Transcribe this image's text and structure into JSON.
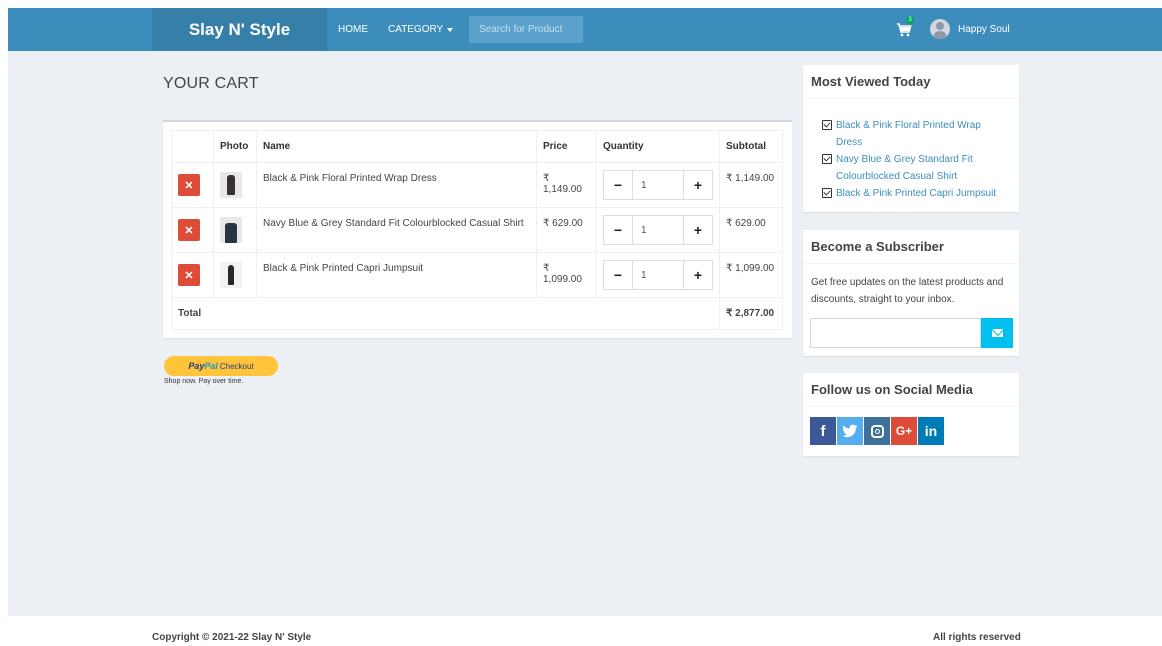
{
  "brand": {
    "name": "Slay N' Style"
  },
  "nav": {
    "home": "HOME",
    "category": "CATEGORY",
    "search_placeholder": "Search for Product",
    "cart_count": "3",
    "user_name": "Happy Soul"
  },
  "cart": {
    "title": "YOUR CART",
    "columns": [
      "",
      "Photo",
      "Name",
      "Price",
      "Quantity",
      "Subtotal"
    ],
    "items": [
      {
        "name": "Black & Pink Floral Printed Wrap Dress",
        "price": "₹ 1,149.00",
        "quantity": "1",
        "subtotal": "₹ 1,149.00"
      },
      {
        "name": "Navy Blue & Grey Standard Fit Colourblocked Casual Shirt",
        "price": "₹ 629.00",
        "quantity": "1",
        "subtotal": "₹ 629.00"
      },
      {
        "name": "Black & Pink Printed Capri Jumpsuit",
        "price": "₹ 1,099.00",
        "quantity": "1",
        "subtotal": "₹ 1,099.00"
      }
    ],
    "total_label": "Total",
    "total_value": "₹ 2,877.00"
  },
  "paypal": {
    "pay": "Pay",
    "pal": "Pal",
    "checkout": "Checkout",
    "tagline": "Shop now. Pay over time."
  },
  "sidebar": {
    "most_viewed": {
      "title": "Most Viewed Today",
      "items": [
        "Black & Pink Floral Printed Wrap Dress",
        "Navy Blue & Grey Standard Fit Colourblocked Casual Shirt",
        "Black & Pink Printed Capri Jumpsuit"
      ]
    },
    "subscriber": {
      "title": "Become a Subscriber",
      "text": "Get free updates on the latest products and discounts, straight to your inbox."
    },
    "social": {
      "title": "Follow us on Social Media",
      "icons": [
        "facebook-icon",
        "twitter-icon",
        "instagram-icon",
        "google-plus-icon",
        "linkedin-icon"
      ]
    }
  },
  "footer": {
    "copyright": "Copyright © 2021-22 Slay N' Style",
    "rights": "All rights reserved"
  },
  "colors": {
    "navbar": "#3c8dbc",
    "brand_bg": "#367fa9",
    "remove": "#dd4b39",
    "subscribe": "#00c0ef",
    "paypal": "#ffc439"
  }
}
